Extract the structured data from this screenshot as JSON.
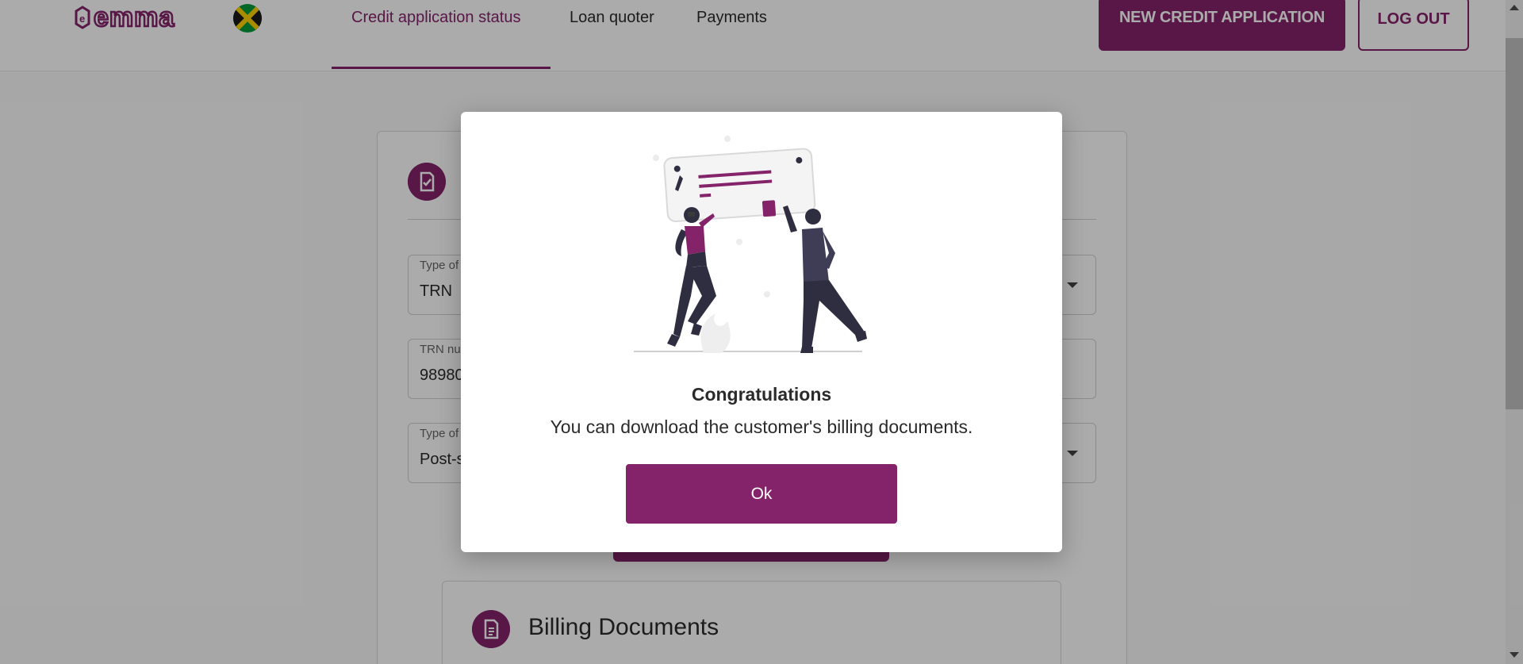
{
  "brand": {
    "name": "emma",
    "accent_color": "#84236a",
    "flag_icon": "jamaica-flag-icon"
  },
  "nav": {
    "tabs": [
      {
        "label": "Credit application status",
        "active": true
      },
      {
        "label": "Loan quoter",
        "active": false
      },
      {
        "label": "Payments",
        "active": false
      }
    ],
    "new_application_label": "NEW CREDIT APPLICATION",
    "logout_label": "LOG OUT"
  },
  "form": {
    "fields": [
      {
        "label": "Type of",
        "value": "TRN",
        "dropdown": true
      },
      {
        "label": "TRN nu",
        "value": "98980",
        "dropdown": false
      },
      {
        "label": "Type of",
        "value": "Post-s",
        "dropdown": true
      }
    ]
  },
  "billing": {
    "title": "Billing Documents"
  },
  "modal": {
    "title": "Congratulations",
    "message": "You can download the customer's billing documents.",
    "ok_label": "Ok",
    "illustration": "celebration-illustration"
  }
}
